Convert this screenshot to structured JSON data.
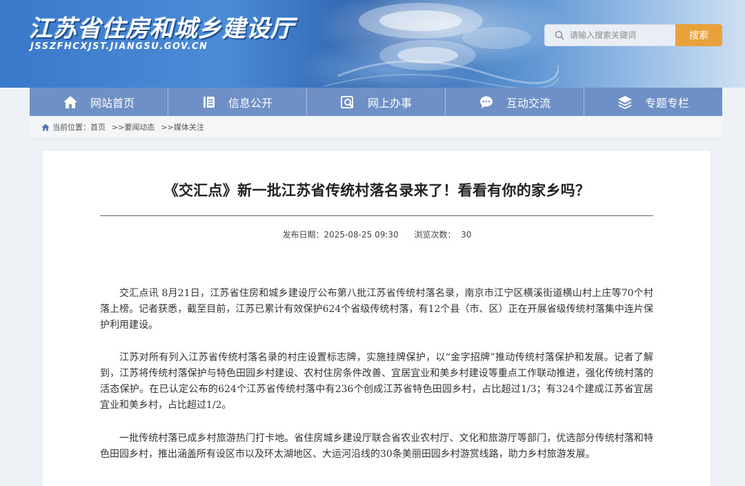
{
  "header": {
    "site_title": "江苏省住房和城乡建设厅",
    "site_domain": "JSSZFHCXJST.JIANGSU.GOV.CN",
    "search": {
      "placeholder": "请输入搜索关键词",
      "button_label": "搜索"
    }
  },
  "nav": {
    "items": [
      {
        "label": "网站首页",
        "icon": "home-icon"
      },
      {
        "label": "信息公开",
        "icon": "document-icon"
      },
      {
        "label": "网上办事",
        "icon": "online-service-icon"
      },
      {
        "label": "互动交流",
        "icon": "chat-icon"
      },
      {
        "label": "专题专栏",
        "icon": "layers-icon"
      }
    ]
  },
  "breadcrumb": {
    "prefix": "当前位置：",
    "items": [
      "首页",
      ">>要闻动态",
      ">>媒体关注"
    ]
  },
  "article": {
    "title": "《交汇点》新一批江苏省传统村落名录来了！看看有你的家乡吗？",
    "publish_label": "发布日期：",
    "publish_date": "2025-08-25 09:30",
    "views_label": "浏览次数：",
    "views": "30",
    "paragraphs": [
      "交汇点讯 8月21日，江苏省住房和城乡建设厅公布第八批江苏省传统村落名录，南京市江宁区横溪街道横山村上庄等70个村落上榜。记者获悉，截至目前，江苏已累计有效保护624个省级传统村落，有12个县（市、区）正在开展省级传统村落集中连片保护利用建设。",
      "江苏对所有列入江苏省传统村落名录的村庄设置标志牌，实施挂牌保护，以“金字招牌”推动传统村落保护和发展。记者了解到，江苏将传统村落保护与特色田园乡村建设、农村住房条件改善、宜居宜业和美乡村建设等重点工作联动推进，强化传统村落的活态保护。在已认定公布的624个江苏省传统村落中有236个创成江苏省特色田园乡村，占比超过1/3；有324个建成江苏省宜居宜业和美乡村，占比超过1/2。",
      "一批传统村落已成乡村旅游热门打卡地。省住房城乡建设厅联合省农业农村厅、文化和旅游厅等部门，优选部分传统村落和特色田园乡村，推出涵盖所有设区市以及环太湖地区、大运河沿线的30条美丽田园乡村游赏线路，助力乡村旅游发展。"
    ]
  },
  "colors": {
    "nav_bg": "#6e90c7",
    "search_button": "#e9a13b",
    "page_bg": "#eef1f6"
  }
}
